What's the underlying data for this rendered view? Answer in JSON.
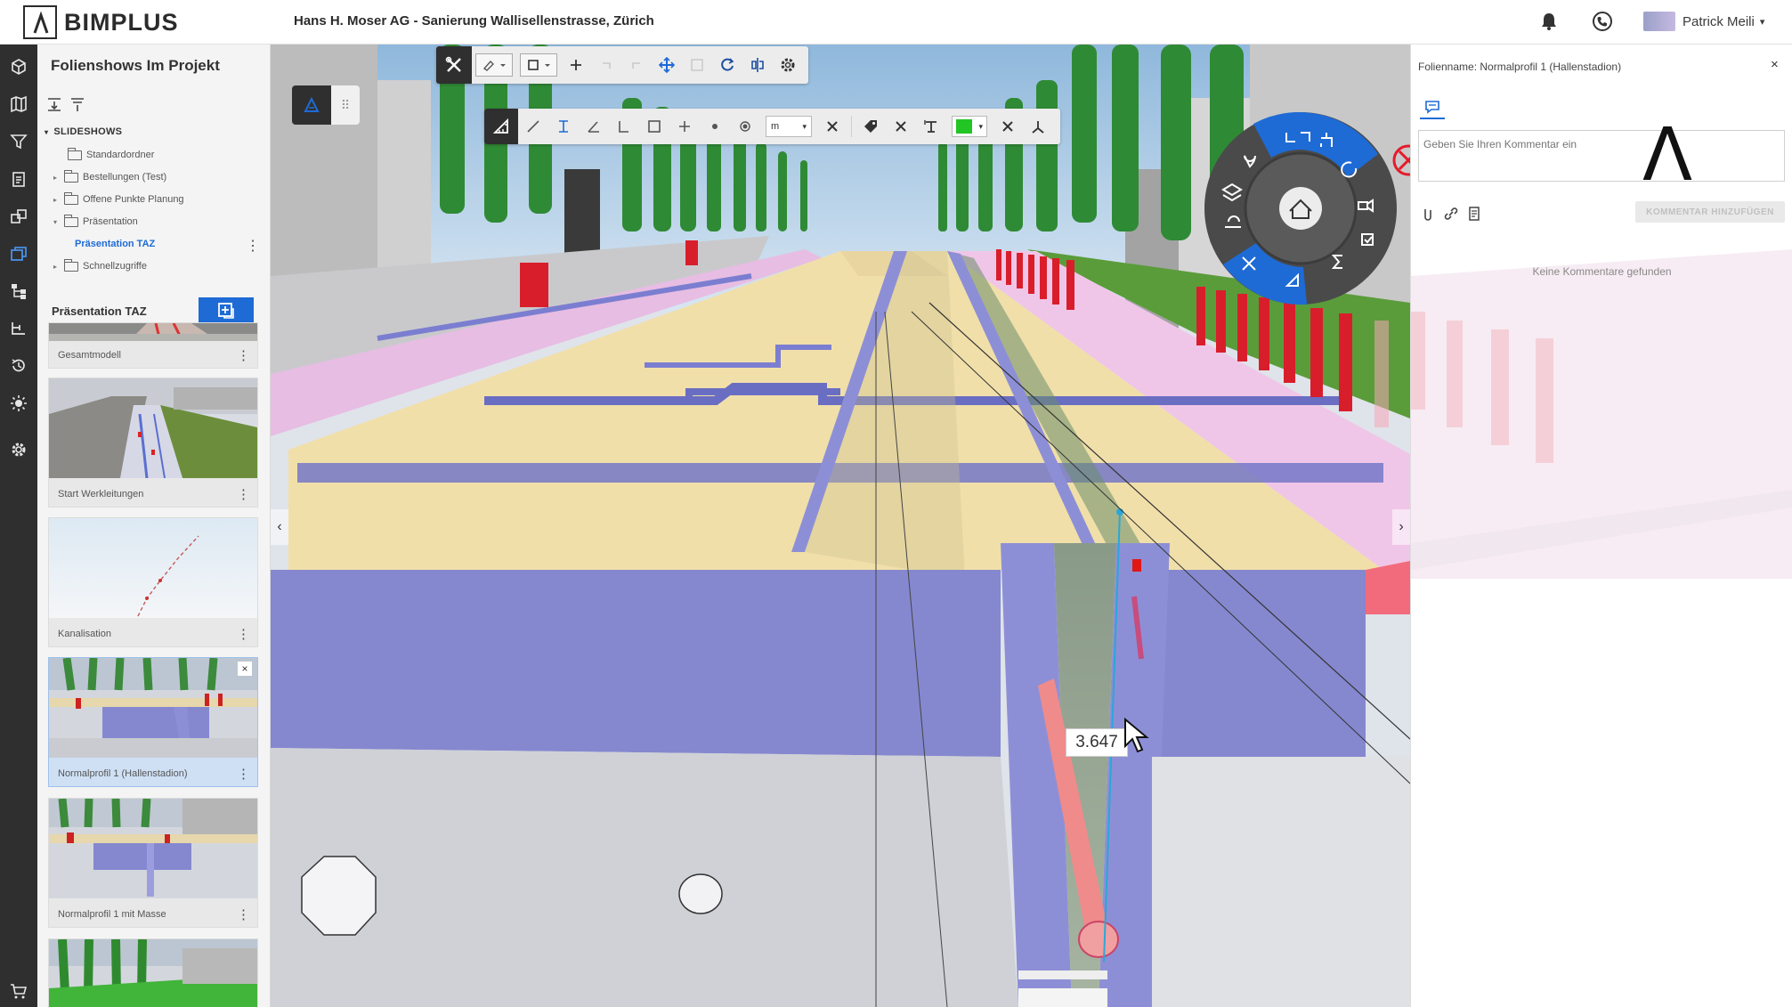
{
  "app": {
    "logo_text": "BIMPLUS",
    "project_title": "Hans H. Moser AG  -  Sanierung Wallisellenstrasse, Zürich",
    "user_name": "Patrick Meili",
    "user_caret": "▾"
  },
  "rail": {
    "icons": [
      "cube-icon",
      "map-icon",
      "filter-icon",
      "clipboard-icon",
      "layers-icon",
      "slides-icon",
      "hierarchy-icon",
      "tree-icon",
      "history-icon",
      "sun-icon",
      "gear-icon",
      "cart-icon"
    ]
  },
  "panel": {
    "title": "Folienshows Im Projekt",
    "slideshows_heading": "SLIDESHOWS",
    "tree": [
      {
        "label": "Standardordner",
        "caret": ""
      },
      {
        "label": "Bestellungen (Test)",
        "caret": "▸"
      },
      {
        "label": "Offene Punkte Planung",
        "caret": "▸"
      },
      {
        "label": "Präsentation",
        "caret": "▾"
      },
      {
        "label": "Präsentation TAZ",
        "caret": ""
      },
      {
        "label": "Schnellzugriffe",
        "caret": "▸"
      }
    ],
    "tree_more": "⋮",
    "presentation_title": "Präsentation TAZ",
    "slides": [
      {
        "caption": "Gesamtmodell",
        "more": "⋮"
      },
      {
        "caption": "Start Werkleitungen",
        "more": "⋮"
      },
      {
        "caption": "Kanalisation",
        "more": "⋮"
      },
      {
        "caption": "Normalprofil 1 (Hallenstadion)",
        "more": "⋮",
        "close": "×"
      },
      {
        "caption": "Normalprofil 1 mit Masse",
        "more": "⋮"
      },
      {
        "caption": "",
        "more": ""
      }
    ]
  },
  "viewport": {
    "unit_value": "m",
    "unit_caret": "▾",
    "color_caret": "▾",
    "measure_value": "3.647",
    "nav_left": "‹",
    "nav_right": "›",
    "mini_tool_b": "⠿",
    "colors": {
      "accent": "#1e6bd6",
      "wall_purple": "#8d8fd6",
      "road_tan": "#f1dfaa",
      "barrier_red": "#d91e2b"
    }
  },
  "comments": {
    "slide_name": "Folienname: Normalprofil 1 (Hallenstadion)",
    "close": "×",
    "input_placeholder": "Geben Sie Ihren Kommentar ein",
    "big_glyph": "Λ",
    "add_button": "KOMMENTAR HINZUFÜGEN",
    "empty_text": "Keine Kommentare gefunden"
  }
}
